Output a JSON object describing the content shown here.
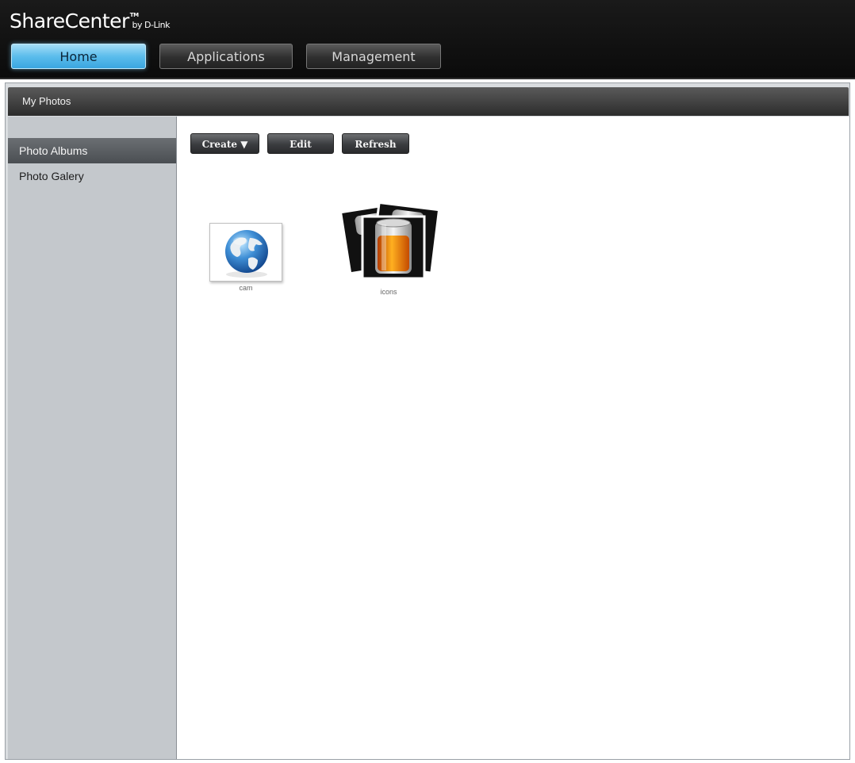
{
  "header": {
    "logo": "ShareCenter",
    "trademark": "TM",
    "by_line": "by D-Link",
    "nav": [
      {
        "label": "Home",
        "active": true
      },
      {
        "label": "Applications",
        "active": false
      },
      {
        "label": "Management",
        "active": false
      }
    ]
  },
  "panel": {
    "title": "My Photos"
  },
  "sidebar": {
    "items": [
      {
        "label": "Photo Albums",
        "active": true
      },
      {
        "label": "Photo Galery",
        "active": false
      }
    ]
  },
  "toolbar": {
    "create_label": "Create ▼",
    "edit_label": "Edit",
    "refresh_label": "Refresh"
  },
  "albums": [
    {
      "name": "cam",
      "icon": "globe-icon"
    },
    {
      "name": "icons",
      "icon": "battery-stack-icon"
    }
  ],
  "colors": {
    "accent": "#5cbdec",
    "topbar": "#111111",
    "sidebar": "#c4c8cc"
  }
}
